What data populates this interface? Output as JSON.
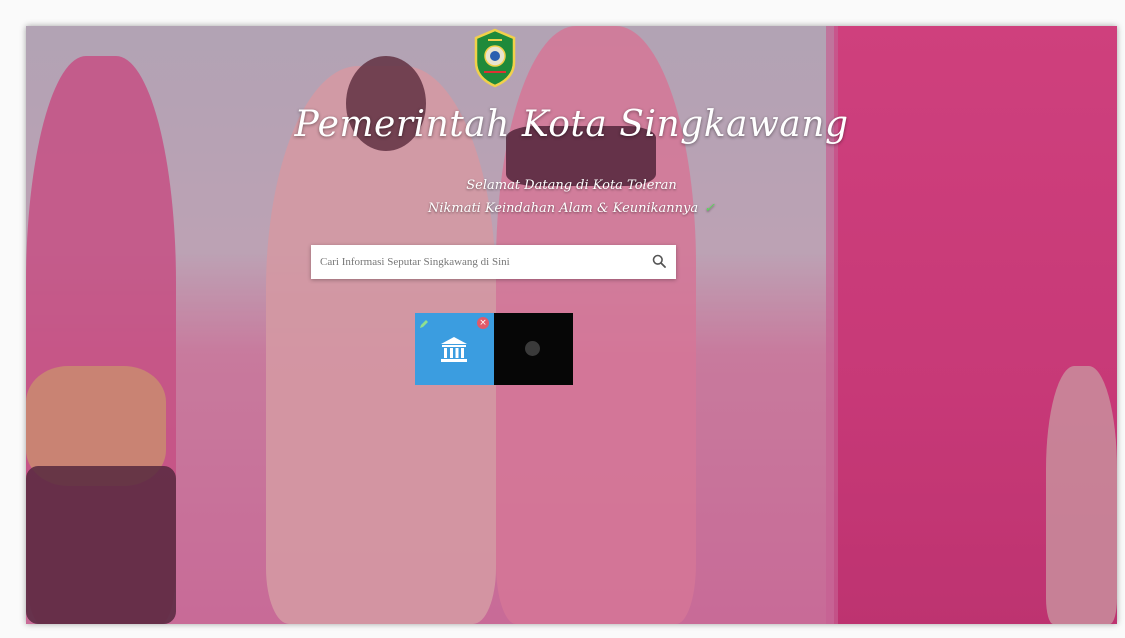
{
  "header": {
    "title": "Pemerintah Kota Singkawang",
    "tagline_1": "Selamat Datang di Kota Toleran",
    "tagline_2": "Nikmati Keindahan Alam & Keunikannya",
    "tagline_2_check": "✓"
  },
  "search": {
    "placeholder": "Cari Informasi Seputar Singkawang di Sini",
    "value": ""
  },
  "tiles": {
    "close_glyph": "×"
  },
  "icons": {
    "logo": "city-emblem-icon",
    "search": "search-icon",
    "tile_1": "government-building-icon",
    "tile_2": "media-dot-icon",
    "close": "close-icon",
    "edit": "pencil-icon"
  },
  "colors": {
    "tile_blue": "#3b9de0",
    "tile_dark": "#060606",
    "curtain": "#d13f7c",
    "close_badge": "#e05a6a"
  }
}
